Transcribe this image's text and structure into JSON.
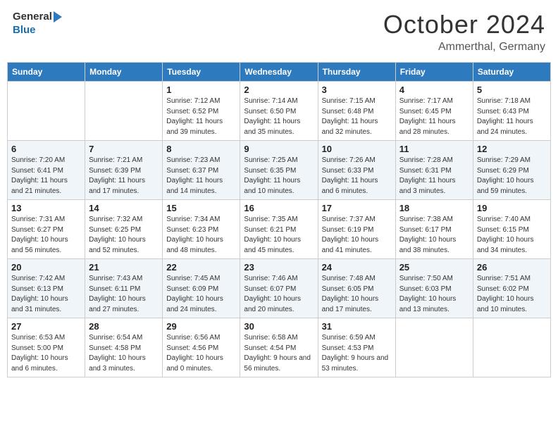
{
  "header": {
    "logo_general": "General",
    "logo_blue": "Blue",
    "month_title": "October 2024",
    "location": "Ammerthal, Germany"
  },
  "weekdays": [
    "Sunday",
    "Monday",
    "Tuesday",
    "Wednesday",
    "Thursday",
    "Friday",
    "Saturday"
  ],
  "weeks": [
    [
      {
        "day": "",
        "info": ""
      },
      {
        "day": "",
        "info": ""
      },
      {
        "day": "1",
        "info": "Sunrise: 7:12 AM\nSunset: 6:52 PM\nDaylight: 11 hours and 39 minutes."
      },
      {
        "day": "2",
        "info": "Sunrise: 7:14 AM\nSunset: 6:50 PM\nDaylight: 11 hours and 35 minutes."
      },
      {
        "day": "3",
        "info": "Sunrise: 7:15 AM\nSunset: 6:48 PM\nDaylight: 11 hours and 32 minutes."
      },
      {
        "day": "4",
        "info": "Sunrise: 7:17 AM\nSunset: 6:45 PM\nDaylight: 11 hours and 28 minutes."
      },
      {
        "day": "5",
        "info": "Sunrise: 7:18 AM\nSunset: 6:43 PM\nDaylight: 11 hours and 24 minutes."
      }
    ],
    [
      {
        "day": "6",
        "info": "Sunrise: 7:20 AM\nSunset: 6:41 PM\nDaylight: 11 hours and 21 minutes."
      },
      {
        "day": "7",
        "info": "Sunrise: 7:21 AM\nSunset: 6:39 PM\nDaylight: 11 hours and 17 minutes."
      },
      {
        "day": "8",
        "info": "Sunrise: 7:23 AM\nSunset: 6:37 PM\nDaylight: 11 hours and 14 minutes."
      },
      {
        "day": "9",
        "info": "Sunrise: 7:25 AM\nSunset: 6:35 PM\nDaylight: 11 hours and 10 minutes."
      },
      {
        "day": "10",
        "info": "Sunrise: 7:26 AM\nSunset: 6:33 PM\nDaylight: 11 hours and 6 minutes."
      },
      {
        "day": "11",
        "info": "Sunrise: 7:28 AM\nSunset: 6:31 PM\nDaylight: 11 hours and 3 minutes."
      },
      {
        "day": "12",
        "info": "Sunrise: 7:29 AM\nSunset: 6:29 PM\nDaylight: 10 hours and 59 minutes."
      }
    ],
    [
      {
        "day": "13",
        "info": "Sunrise: 7:31 AM\nSunset: 6:27 PM\nDaylight: 10 hours and 56 minutes."
      },
      {
        "day": "14",
        "info": "Sunrise: 7:32 AM\nSunset: 6:25 PM\nDaylight: 10 hours and 52 minutes."
      },
      {
        "day": "15",
        "info": "Sunrise: 7:34 AM\nSunset: 6:23 PM\nDaylight: 10 hours and 48 minutes."
      },
      {
        "day": "16",
        "info": "Sunrise: 7:35 AM\nSunset: 6:21 PM\nDaylight: 10 hours and 45 minutes."
      },
      {
        "day": "17",
        "info": "Sunrise: 7:37 AM\nSunset: 6:19 PM\nDaylight: 10 hours and 41 minutes."
      },
      {
        "day": "18",
        "info": "Sunrise: 7:38 AM\nSunset: 6:17 PM\nDaylight: 10 hours and 38 minutes."
      },
      {
        "day": "19",
        "info": "Sunrise: 7:40 AM\nSunset: 6:15 PM\nDaylight: 10 hours and 34 minutes."
      }
    ],
    [
      {
        "day": "20",
        "info": "Sunrise: 7:42 AM\nSunset: 6:13 PM\nDaylight: 10 hours and 31 minutes."
      },
      {
        "day": "21",
        "info": "Sunrise: 7:43 AM\nSunset: 6:11 PM\nDaylight: 10 hours and 27 minutes."
      },
      {
        "day": "22",
        "info": "Sunrise: 7:45 AM\nSunset: 6:09 PM\nDaylight: 10 hours and 24 minutes."
      },
      {
        "day": "23",
        "info": "Sunrise: 7:46 AM\nSunset: 6:07 PM\nDaylight: 10 hours and 20 minutes."
      },
      {
        "day": "24",
        "info": "Sunrise: 7:48 AM\nSunset: 6:05 PM\nDaylight: 10 hours and 17 minutes."
      },
      {
        "day": "25",
        "info": "Sunrise: 7:50 AM\nSunset: 6:03 PM\nDaylight: 10 hours and 13 minutes."
      },
      {
        "day": "26",
        "info": "Sunrise: 7:51 AM\nSunset: 6:02 PM\nDaylight: 10 hours and 10 minutes."
      }
    ],
    [
      {
        "day": "27",
        "info": "Sunrise: 6:53 AM\nSunset: 5:00 PM\nDaylight: 10 hours and 6 minutes."
      },
      {
        "day": "28",
        "info": "Sunrise: 6:54 AM\nSunset: 4:58 PM\nDaylight: 10 hours and 3 minutes."
      },
      {
        "day": "29",
        "info": "Sunrise: 6:56 AM\nSunset: 4:56 PM\nDaylight: 10 hours and 0 minutes."
      },
      {
        "day": "30",
        "info": "Sunrise: 6:58 AM\nSunset: 4:54 PM\nDaylight: 9 hours and 56 minutes."
      },
      {
        "day": "31",
        "info": "Sunrise: 6:59 AM\nSunset: 4:53 PM\nDaylight: 9 hours and 53 minutes."
      },
      {
        "day": "",
        "info": ""
      },
      {
        "day": "",
        "info": ""
      }
    ]
  ]
}
